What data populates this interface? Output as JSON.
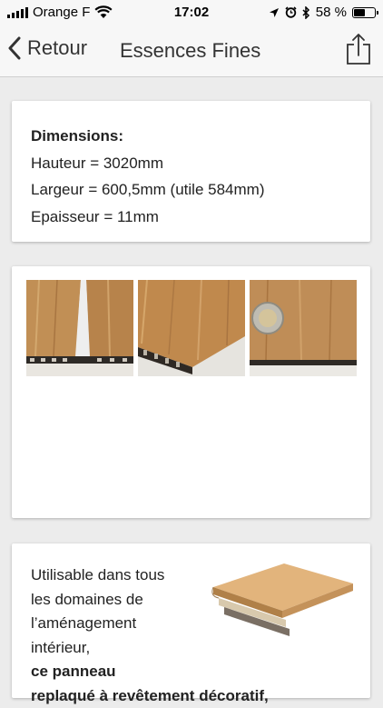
{
  "status_bar": {
    "carrier": "Orange F",
    "time": "17:02",
    "battery_percent": "58 %",
    "battery_level": 0.58,
    "icons": [
      "signal-icon",
      "wifi-icon",
      "location-icon",
      "alarm-icon",
      "bluetooth-icon",
      "battery-icon"
    ]
  },
  "nav": {
    "back_label": "Retour",
    "title": "Essences Fines",
    "icons": [
      "chevron-left-icon",
      "share-icon"
    ]
  },
  "dimensions": {
    "heading": "Dimensions:",
    "height": "Hauteur = 3020mm",
    "width": "Largeur = 600,5mm (utile 584mm)",
    "thickness": "Epaisseur = 11mm"
  },
  "description": {
    "line1": "Utilisable dans tous",
    "line2": "les domaines de",
    "line3": "l’aménagement",
    "line4_plain": "intérieur, ",
    "line4_bold": "ce panneau",
    "line5_bold": "replaqué à revêtement décoratif,"
  },
  "colors": {
    "background": "#ececec",
    "bar": "#f7f7f7",
    "card": "#ffffff",
    "text": "#222222"
  }
}
